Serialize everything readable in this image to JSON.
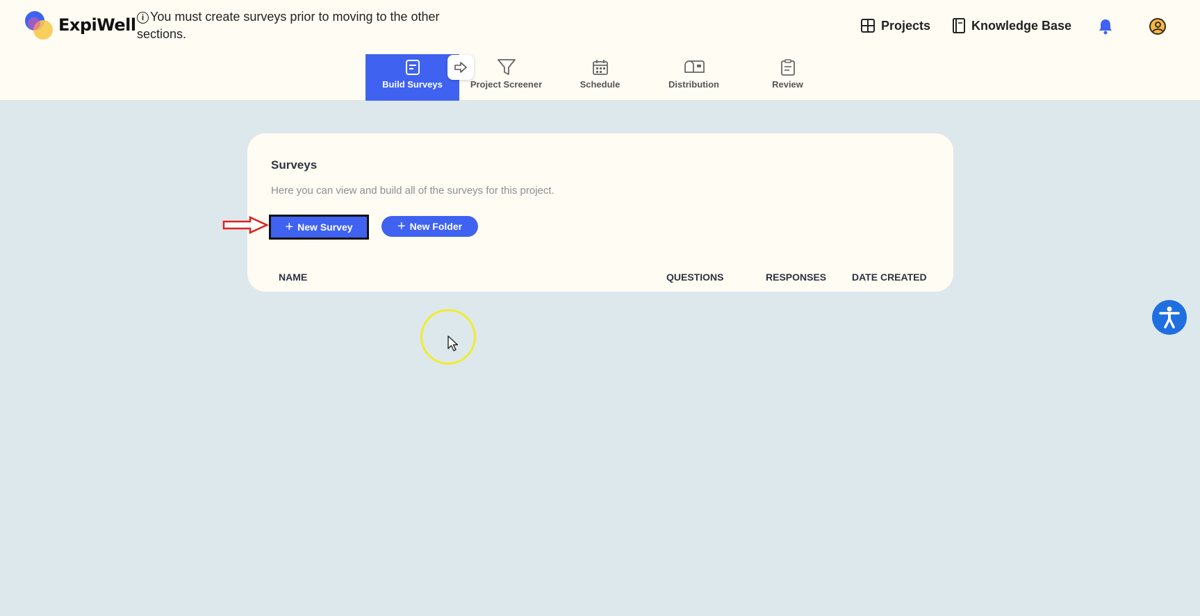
{
  "header": {
    "brand": "ExpiWell",
    "notice_icon": "info-icon",
    "notice": "You must create surveys prior to moving to the other sections.",
    "projects_label": "Projects",
    "knowledge_base_label": "Knowledge Base"
  },
  "stepper": {
    "steps": [
      {
        "label": "Build Surveys",
        "icon": "document-icon",
        "active": true
      },
      {
        "label": "Project Screener",
        "icon": "filter-icon",
        "active": false
      },
      {
        "label": "Schedule",
        "icon": "calendar-icon",
        "active": false
      },
      {
        "label": "Distribution",
        "icon": "mailbox-icon",
        "active": false
      },
      {
        "label": "Review",
        "icon": "clipboard-icon",
        "active": false
      }
    ]
  },
  "surveys": {
    "title": "Surveys",
    "subtitle": "Here you can view and build all of the surveys for this project.",
    "new_survey_label": "New Survey",
    "new_folder_label": "New Folder",
    "columns": [
      "NAME",
      "QUESTIONS",
      "RESPONSES",
      "DATE CREATED"
    ]
  },
  "colors": {
    "accent": "#3f63f0",
    "background": "#dde8ec",
    "surface": "#fffcf3",
    "annotation_red": "#e02020",
    "cursor_highlight": "#f0ec2a",
    "accessibility": "#1f6fe0"
  }
}
